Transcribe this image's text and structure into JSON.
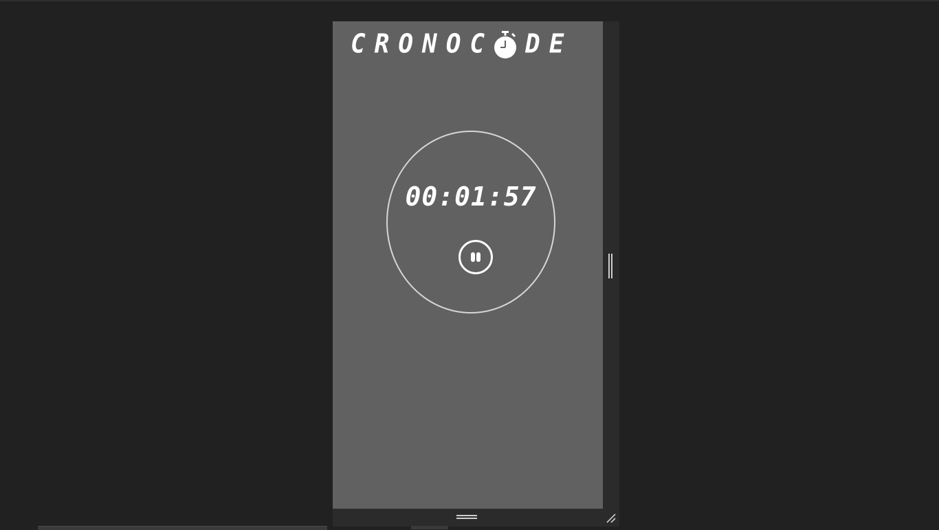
{
  "app": {
    "logo_text_before": "CRONOC",
    "logo_text_after": "DE",
    "logo_icon": "stopwatch-icon"
  },
  "timer": {
    "time": "00:01:57",
    "pause_icon": "pause-icon",
    "state": "running"
  },
  "device_toolbar": {
    "width_handle_icon": "vertical-grip-icon",
    "height_handle_icon": "horizontal-grip-icon",
    "corner_handle_icon": "diagonal-resize-icon"
  },
  "colors": {
    "page_background": "#212121",
    "app_background": "#616161",
    "frame_background": "#2b2b2b",
    "foreground": "#ffffff",
    "ring": "#d6d6d6"
  }
}
